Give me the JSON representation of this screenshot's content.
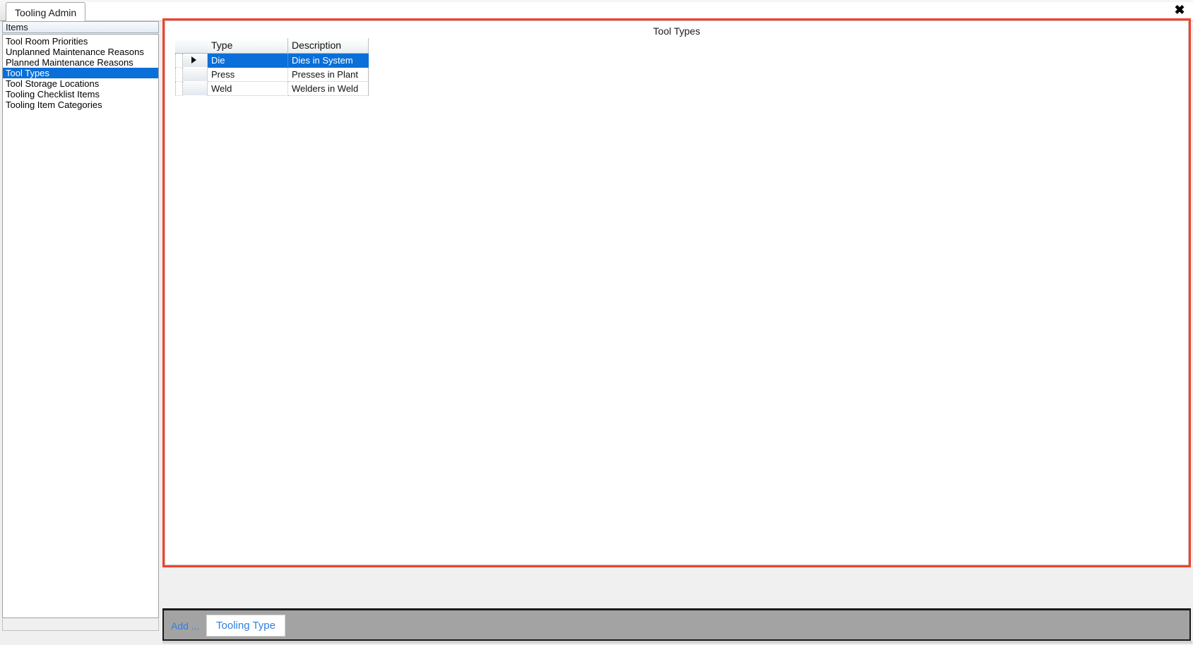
{
  "window": {
    "tab_label": "Tooling Admin",
    "close_icon": "close-icon",
    "close_glyph": "✖"
  },
  "sidebar": {
    "header": "Items",
    "items": [
      {
        "label": "Tool Room Priorities",
        "selected": false
      },
      {
        "label": "Unplanned Maintenance Reasons",
        "selected": false
      },
      {
        "label": "Planned Maintenance Reasons",
        "selected": false
      },
      {
        "label": "Tool Types",
        "selected": true
      },
      {
        "label": "Tool Storage Locations",
        "selected": false
      },
      {
        "label": "Tooling Checklist Items",
        "selected": false
      },
      {
        "label": "Tooling Item Categories",
        "selected": false
      }
    ]
  },
  "main": {
    "title": "Tool Types",
    "grid": {
      "columns": [
        "Type",
        "Description"
      ],
      "rows": [
        {
          "type": "Die",
          "description": "Dies in System",
          "selected": true,
          "indicator": "row-selector-arrow"
        },
        {
          "type": "Press",
          "description": "Presses in Plant",
          "selected": false,
          "indicator": ""
        },
        {
          "type": "Weld",
          "description": "Welders in Weld",
          "selected": false,
          "indicator": ""
        }
      ]
    }
  },
  "toolbar": {
    "add_label": "Add ...",
    "add_button_label": "Tooling Type"
  },
  "colors": {
    "selection_blue": "#0a6fd8",
    "panel_border_red": "#f5402c",
    "toolbar_gray": "#a3a3a3",
    "link_blue": "#2f7fe0"
  }
}
